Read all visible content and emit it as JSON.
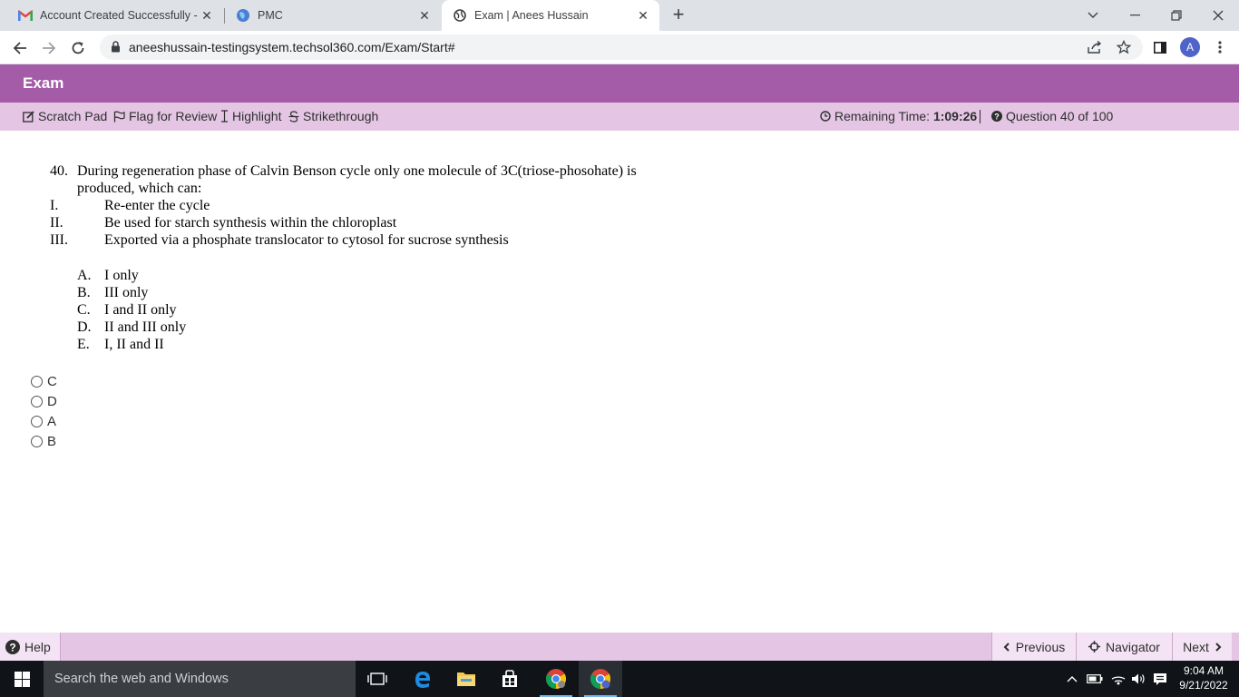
{
  "browser": {
    "tabs": [
      {
        "title": "Account Created Successfully - ar",
        "icon": "gmail-icon"
      },
      {
        "title": "PMC",
        "icon": "globe-icon"
      },
      {
        "title": "Exam | Anees Hussain",
        "icon": "web-icon",
        "active": true
      }
    ],
    "url": "aneeshussain-testingsystem.techsol360.com/Exam/Start#",
    "profile_initial": "A"
  },
  "exam": {
    "header_title": "Exam",
    "tools": {
      "scratch_pad": "Scratch Pad",
      "flag_for_review": "Flag for Review",
      "highlight": "Highlight",
      "strikethrough": "Strikethrough"
    },
    "remaining_time_label": "Remaining Time:",
    "remaining_time_value": "1:09:26",
    "question_counter": "Question 40 of 100"
  },
  "question": {
    "number": "40.",
    "stem_line1": "During regeneration phase of Calvin Benson cycle only one molecule of 3C(triose-phosohate) is",
    "stem_line2": "produced, which can:",
    "statements": [
      {
        "numeral": "I.",
        "text": "Re-enter the cycle"
      },
      {
        "numeral": "II.",
        "text": "Be used for starch synthesis within the chloroplast"
      },
      {
        "numeral": "III.",
        "text": "Exported via a phosphate translocator to cytosol for sucrose synthesis"
      }
    ],
    "options": [
      {
        "letter": "A.",
        "text": "I only"
      },
      {
        "letter": "B.",
        "text": "III only"
      },
      {
        "letter": "C.",
        "text": "I and II only"
      },
      {
        "letter": "D.",
        "text": "II and III only"
      },
      {
        "letter": "E.",
        "text": "I, II and II"
      }
    ]
  },
  "answers": [
    {
      "label": "C",
      "selected": false
    },
    {
      "label": "D",
      "selected": false
    },
    {
      "label": "A",
      "selected": false
    },
    {
      "label": "B",
      "selected": false
    }
  ],
  "footer": {
    "help": "Help",
    "previous": "Previous",
    "navigator": "Navigator",
    "next": "Next"
  },
  "taskbar": {
    "search_placeholder": "Search the web and Windows",
    "time": "9:04 AM",
    "date": "9/21/2022"
  },
  "colors": {
    "exam_header": "#a55ca8",
    "exam_toolbar": "#e4c6e4"
  }
}
